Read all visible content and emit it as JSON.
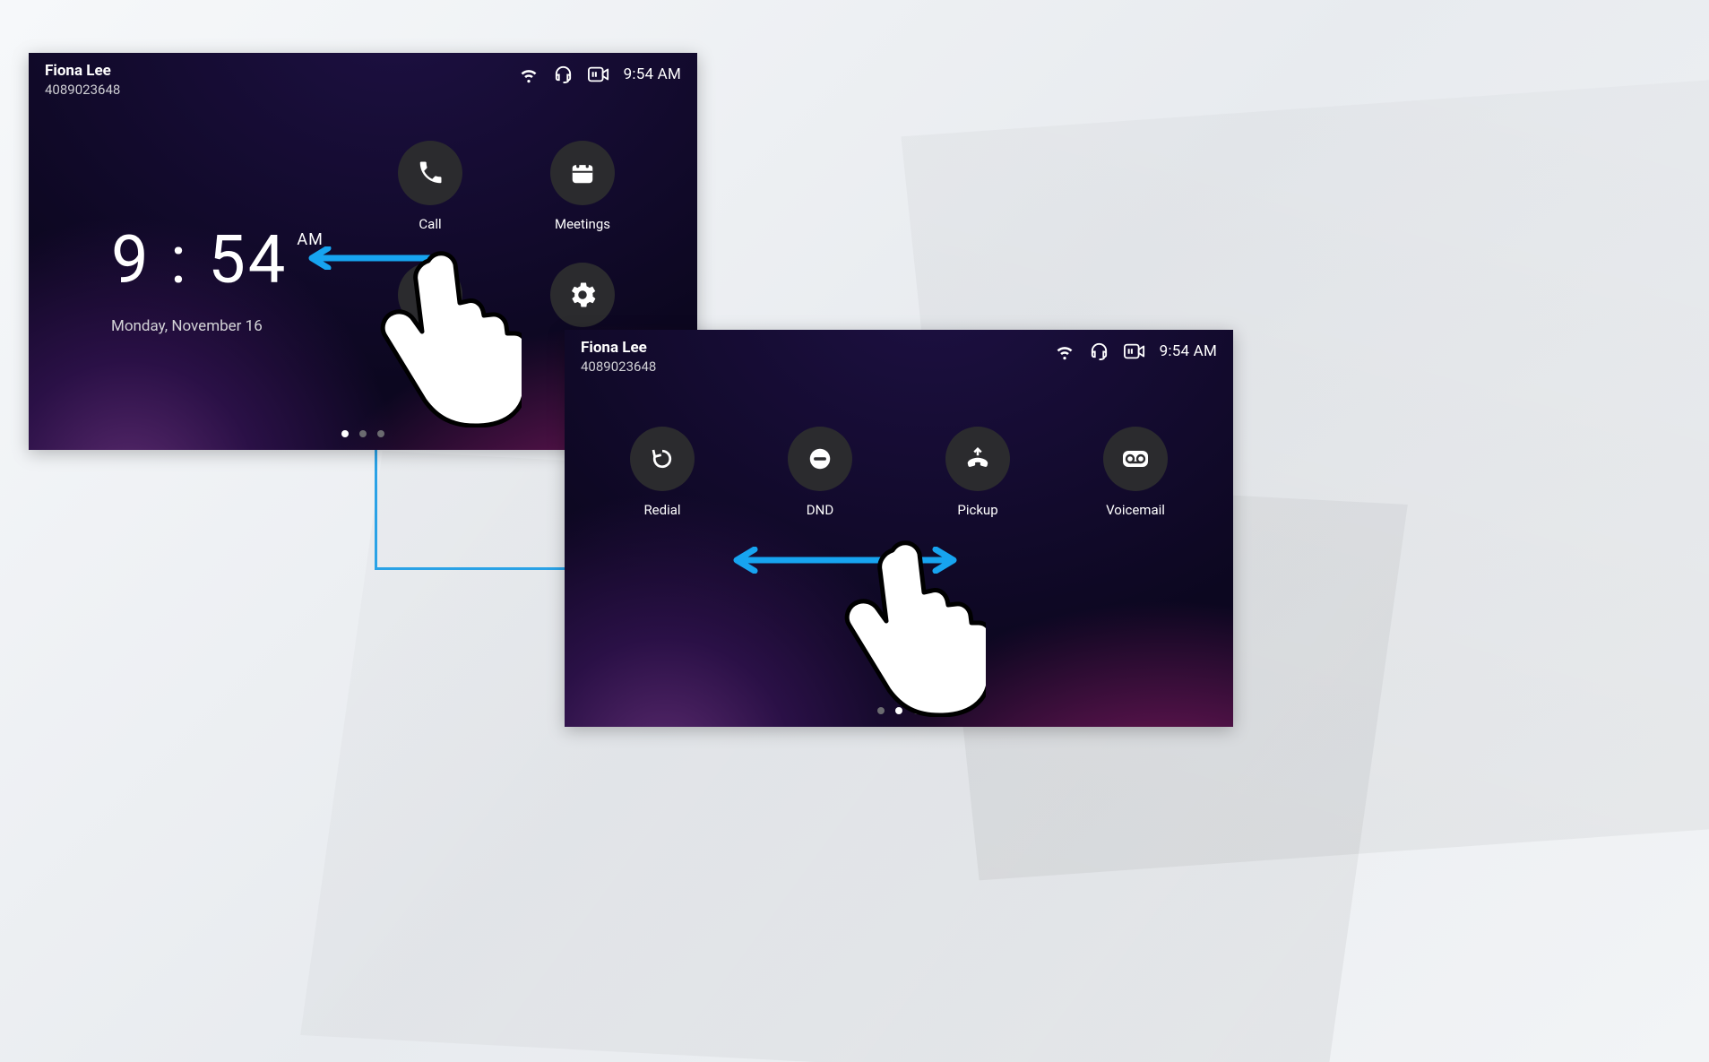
{
  "user": {
    "name": "Fiona Lee",
    "number": "4089023648"
  },
  "status": {
    "time": "9:54 AM"
  },
  "clock": {
    "time": "9 : 54",
    "ampm": "AM",
    "date": "Monday, November 16"
  },
  "device1": {
    "apps": {
      "call": "Call",
      "meetings": "Meetings",
      "settings_partial": "Se",
      "contacts_hidden": ""
    },
    "active_page_index": 0
  },
  "device2": {
    "apps": {
      "redial": "Redial",
      "dnd": "DND",
      "pickup": "Pickup",
      "voicemail": "Voicemail"
    },
    "active_page_index": 1
  },
  "colors": {
    "arrow": "#17a4f0"
  }
}
